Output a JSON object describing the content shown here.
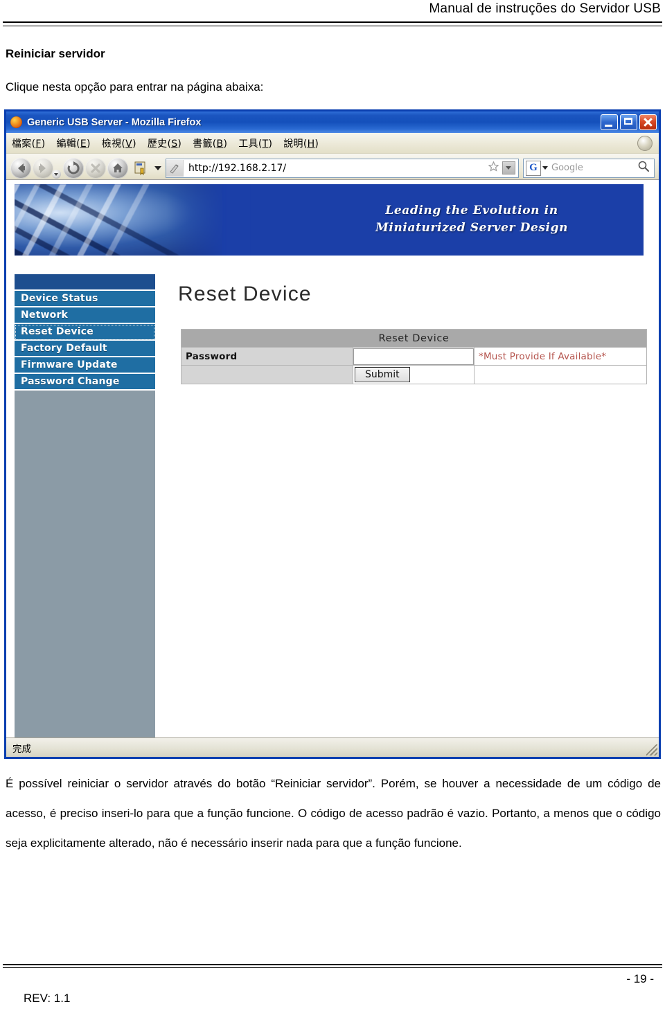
{
  "document": {
    "header_title": "Manual de instruções do Servidor USB",
    "section_title": "Reiniciar servidor",
    "lead_text": "Clique nesta opção para entrar na página abaixa:",
    "paragraph": "É possível reiniciar o servidor através do botão “Reiniciar servidor”. Porém, se houver a necessidade de um código de acesso, é preciso inseri-lo para que a função funcione. O código de acesso padrão é vazio. Portanto, a menos que o código seja explicitamente alterado, não é necessário inserir nada para que a função funcione.",
    "page_number": "- 19 -",
    "revision": "REV: 1.1"
  },
  "browser": {
    "window_title": "Generic USB Server - Mozilla Firefox",
    "window_buttons": {
      "minimize": "Minimizar",
      "maximize": "Maximizar",
      "close": "Fechar"
    },
    "menus": [
      {
        "label": "檔案",
        "accel": "F"
      },
      {
        "label": "編輯",
        "accel": "E"
      },
      {
        "label": "檢視",
        "accel": "V"
      },
      {
        "label": "歷史",
        "accel": "S"
      },
      {
        "label": "書籤",
        "accel": "B"
      },
      {
        "label": "工具",
        "accel": "T"
      },
      {
        "label": "說明",
        "accel": "H"
      }
    ],
    "toolbar": {
      "back": "Voltar",
      "forward": "Avançar",
      "reload": "Recarregar",
      "stop": "Parar",
      "home": "Página inicial"
    },
    "url": "http://192.168.2.17/",
    "search_engine": "G",
    "search_placeholder": "Google",
    "status_text": "完成"
  },
  "site": {
    "tagline_line1": "Leading the Evolution in",
    "tagline_line2": "Miniaturized Server Design",
    "sidebar": [
      {
        "label": "Device Status",
        "selected": false
      },
      {
        "label": "Network",
        "selected": false
      },
      {
        "label": "Reset Device",
        "selected": true
      },
      {
        "label": "Factory Default",
        "selected": false
      },
      {
        "label": "Firmware Update",
        "selected": false
      },
      {
        "label": "Password Change",
        "selected": false
      }
    ],
    "page_heading": "Reset Device",
    "form": {
      "table_header": "Reset Device",
      "password_label": "Password",
      "password_value": "",
      "password_note": "*Must Provide If Available*",
      "submit_label": "Submit"
    }
  },
  "colors": {
    "banner_blue": "#1b3fa8",
    "sidebar_item": "#1f6ea3",
    "sidebar_bg": "#8b9ba6",
    "titlebar_blue": "#1450bb",
    "note_red": "#b5554e",
    "table_header_gray": "#a9a9a9"
  }
}
